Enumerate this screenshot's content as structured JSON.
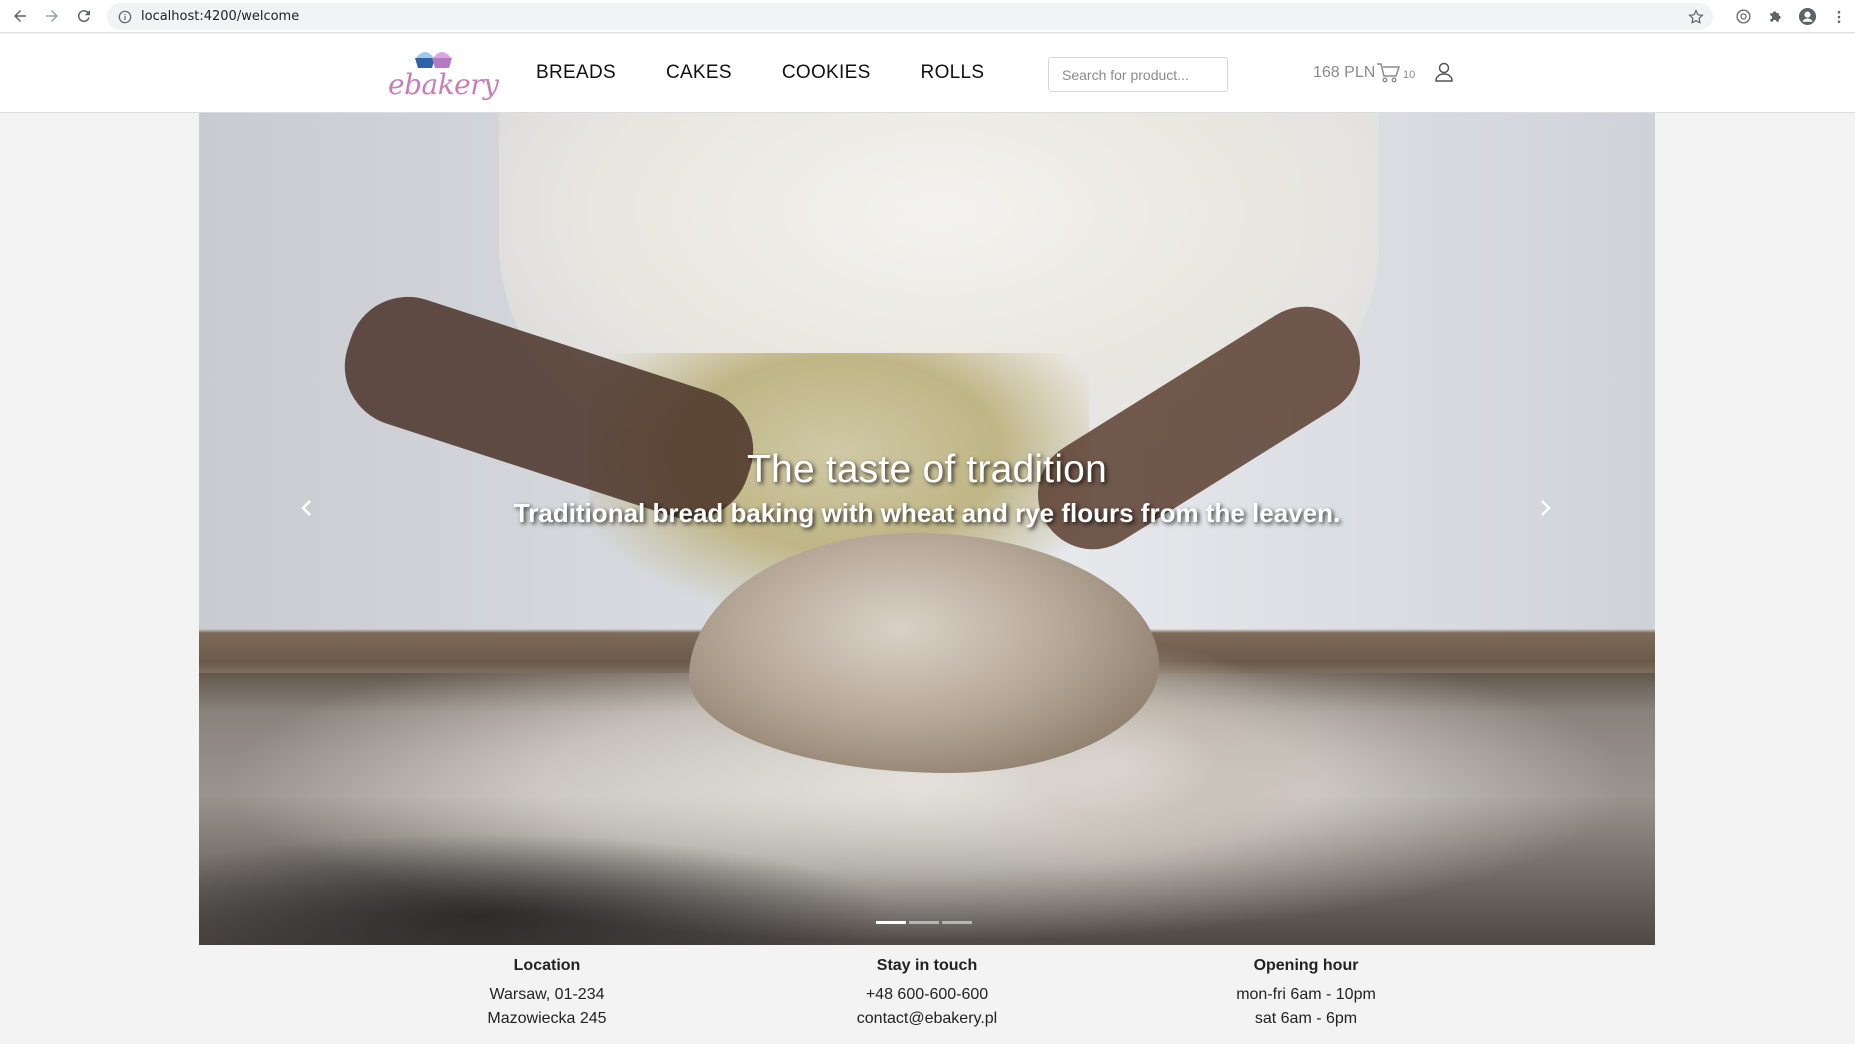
{
  "browser": {
    "url": "localhost:4200/welcome"
  },
  "header": {
    "logo_text": "ebakery",
    "menu": [
      "BREADS",
      "CAKES",
      "COOKIES",
      "ROLLS"
    ],
    "search_placeholder": "Search for product...",
    "cart_total": "168 PLN",
    "cart_count": "10"
  },
  "hero": {
    "title": "The taste of tradition",
    "subtitle": "Traditional bread baking with wheat and rye flours from the leaven.",
    "active_slide": 1,
    "slide_count": 3
  },
  "footer": {
    "location": {
      "heading": "Location",
      "line1": "Warsaw, 01-234",
      "line2": "Mazowiecka 245"
    },
    "contact": {
      "heading": "Stay in touch",
      "line1": "+48 600-600-600",
      "line2": "contact@ebakery.pl"
    },
    "hours": {
      "heading": "Opening hour",
      "line1": "mon-fri 6am - 10pm",
      "line2": "sat 6am - 6pm"
    }
  },
  "colors": {
    "logo": "#c77fb8",
    "muted": "#8b8b8b"
  }
}
